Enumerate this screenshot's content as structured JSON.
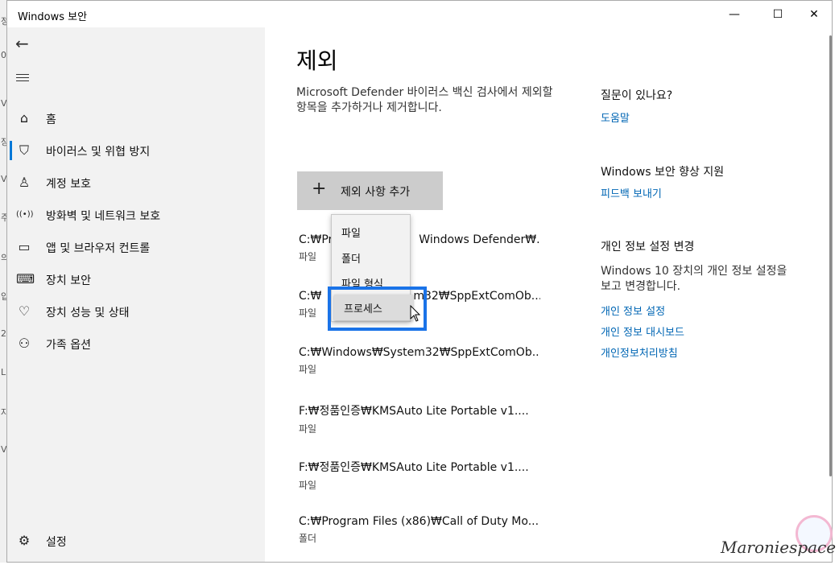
{
  "window": {
    "title": "Windows 보안",
    "minimize": "—",
    "maximize": "☐",
    "close": "✕"
  },
  "outer_strip": [
    "정",
    "0",
    "V",
    "장",
    "V",
    "주",
    "의",
    "입",
    "2",
    "L",
    "자",
    "V"
  ],
  "sidebar": {
    "back_icon": "←",
    "items": [
      {
        "label": "홈",
        "icon": "home-icon",
        "glyph": "⌂"
      },
      {
        "label": "바이러스 및 위협 방지",
        "icon": "shield-icon",
        "glyph": "⛉",
        "active": true
      },
      {
        "label": "계정 보호",
        "icon": "person-icon",
        "glyph": "♙"
      },
      {
        "label": "방화벽 및 네트워크 보호",
        "icon": "wifi-signal-icon",
        "glyph": "((•))"
      },
      {
        "label": "앱 및 브라우저 컨트롤",
        "icon": "browser-window-icon",
        "glyph": "▭"
      },
      {
        "label": "장치 보안",
        "icon": "laptop-icon",
        "glyph": "⌨"
      },
      {
        "label": "장치 성능 및 상태",
        "icon": "heart-pulse-icon",
        "glyph": "♡"
      },
      {
        "label": "가족 옵션",
        "icon": "family-icon",
        "glyph": "⚇"
      }
    ],
    "settings": {
      "label": "설정",
      "icon": "gear-icon",
      "glyph": "⚙"
    }
  },
  "main": {
    "title": "제외",
    "description": "Microsoft Defender 바이러스 백신 검사에서 제외할 항목을 추가하거나 제거합니다.",
    "add_button": {
      "plus": "+",
      "label": "제외 사항 추가"
    },
    "exclusions": [
      {
        "path": "C:₩Pr",
        "path_right": "Windows Defender₩...",
        "type": "파일"
      },
      {
        "path": "C:₩",
        "path_right": "m32₩SppExtComOb...",
        "type": "파일"
      },
      {
        "path": "C:₩Windows₩System32₩SppExtComOb...",
        "type": "파일"
      },
      {
        "path": "F:₩정품인증₩KMSAuto Lite Portable v1....",
        "type": "파일"
      },
      {
        "path": "F:₩정품인증₩KMSAuto Lite Portable v1....",
        "type": "파일"
      },
      {
        "path": "C:₩Program Files (x86)₩Call of Duty Mo...",
        "type": "폴더"
      }
    ],
    "dropdown": {
      "items": [
        "파일",
        "폴더",
        "파일 형식",
        "프로세스"
      ]
    }
  },
  "help": {
    "question_heading": "질문이 있나요?",
    "help_link": "도움말",
    "improve_heading": "Windows 보안 향상 지원",
    "feedback_link": "피드백 보내기",
    "privacy_heading": "개인 정보 설정 변경",
    "privacy_text": "Windows 10 장치의 개인 정보 설정을 보고 변경합니다.",
    "privacy_links": [
      "개인 정보 설정",
      "개인 정보 대시보드",
      "개인정보처리방침"
    ]
  },
  "watermark": "Maroniespace",
  "colors": {
    "accent": "#0078d7",
    "link": "#0066b4",
    "highlight_box": "#1a73e8",
    "sidebar_bg": "#f2f2f2",
    "button_bg": "#cccccc"
  }
}
